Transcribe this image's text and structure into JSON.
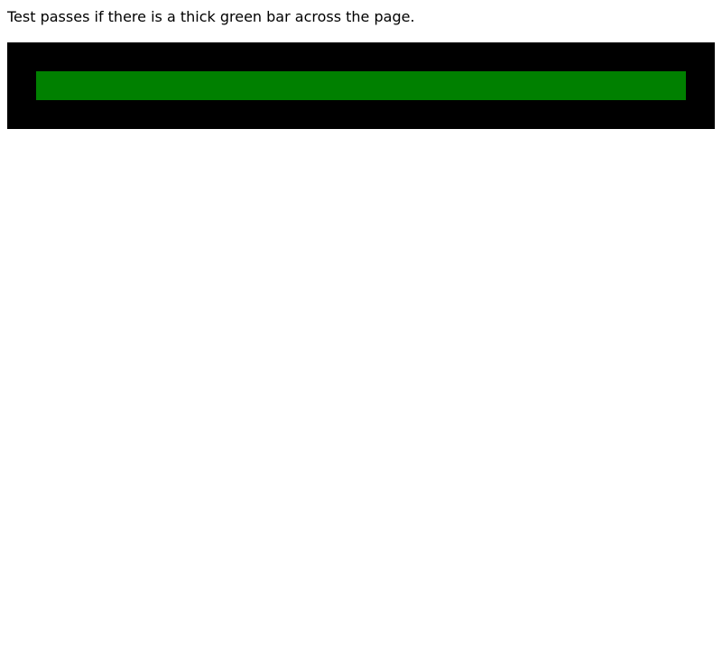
{
  "instruction_text": "Test passes if there is a thick green bar across the page.",
  "colors": {
    "frame": "#000000",
    "bar": "#008000",
    "background": "#ffffff"
  }
}
